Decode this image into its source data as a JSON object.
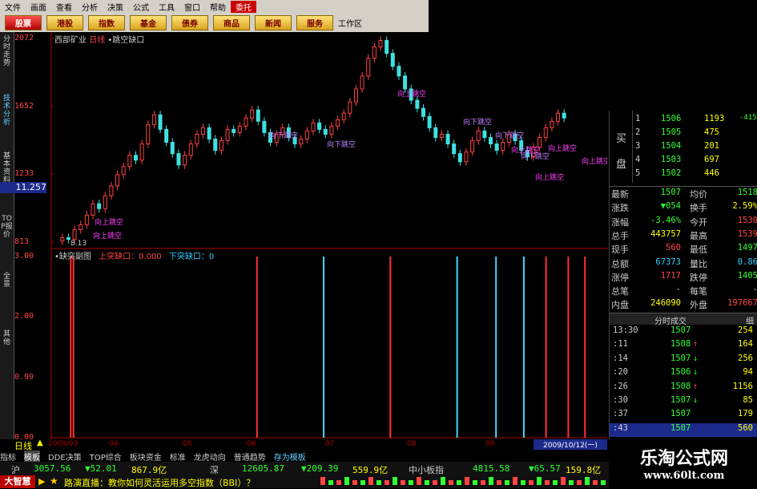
{
  "menu": [
    "文件",
    "画面",
    "查看",
    "分析",
    "决策",
    "公式",
    "工具",
    "窗口",
    "帮助",
    "委托"
  ],
  "buttons": [
    "股票",
    "港股",
    "指数",
    "基金",
    "债券",
    "商品",
    "新闻",
    "服务"
  ],
  "workspace_label": "工作区",
  "left_tabs": [
    "分时走势",
    "技术分析",
    "基本资料",
    "TOP报价",
    "全景",
    "其他"
  ],
  "chart": {
    "title_stock": "西部矿业",
    "title_period": "日线",
    "title_indicator": "•跳空缺口",
    "price_axis": [
      "2072",
      "1652",
      "1233",
      "813"
    ],
    "cursor_value": "11.257",
    "low_mark": "8.13",
    "sub_title": "•缺突副图",
    "sub_up_label": "上突缺口：0.000",
    "sub_down_label": "下突缺口：0",
    "sub_axis": [
      "3.00",
      "2.00",
      "0.99",
      "0.00"
    ],
    "gap_labels": [
      "向上跳空",
      "向上跳空",
      "向下跳空",
      "向下跳空",
      "向上跳空",
      "向下跳空",
      "向下跳空",
      "向上跳空",
      "向下跳空",
      "向上跳空",
      "向上跳空",
      "向上跳空"
    ]
  },
  "chart_data": {
    "type": "candlestick",
    "ylim": [
      8.13,
      20.72
    ],
    "y_ticks": [
      20.72,
      16.52,
      12.33,
      8.13
    ],
    "x_ticks": [
      "2009/03",
      "04",
      "05",
      "06",
      "07",
      "08",
      "09"
    ],
    "closes": [
      8.4,
      8.3,
      8.9,
      9.2,
      9.8,
      10.5,
      10.2,
      11,
      11.6,
      12.3,
      12.8,
      13.5,
      13.2,
      14.2,
      15.4,
      16.0,
      15.1,
      14.3,
      13.6,
      12.9,
      13.5,
      14.2,
      14.8,
      15.2,
      14.5,
      13.8,
      14.4,
      15.1,
      14.9,
      15.3,
      15.8,
      16.3,
      15.6,
      14.9,
      14.3,
      14.8,
      15.2,
      14.6,
      14.2,
      14.5,
      15.0,
      15.5,
      15.1,
      14.8,
      15.3,
      15.7,
      16.1,
      16.8,
      17.6,
      18.4,
      19.5,
      20.2,
      20.6,
      19.8,
      19.0,
      18.4,
      17.6,
      16.9,
      16.4,
      15.9,
      15.2,
      14.6,
      14.8,
      14.2,
      13.6,
      13.1,
      13.7,
      14.4,
      15.0,
      14.6,
      14.2,
      13.8,
      14.3,
      14.8,
      14.4,
      13.8,
      13.4,
      14.0,
      14.6,
      15.2,
      15.6,
      16.1,
      15.8
    ],
    "sub_signal_x": [
      0.035,
      0.04,
      0.37,
      0.49,
      0.61,
      0.73,
      0.8,
      0.85,
      0.89,
      0.93,
      0.96
    ],
    "sub_signal_color": [
      "red",
      "red",
      "red",
      "cyan",
      "red",
      "cyan",
      "cyan",
      "cyan",
      "red",
      "red",
      "red"
    ],
    "sub_signal_value": [
      3,
      3,
      3,
      3,
      3,
      3,
      3,
      3,
      3,
      3,
      3
    ]
  },
  "orderbook": {
    "side_labels": [
      "买",
      "盘"
    ],
    "rows": [
      {
        "n": "1",
        "price": "1506",
        "vol": "1193",
        "chg": "-415"
      },
      {
        "n": "2",
        "price": "1505",
        "vol": "475",
        "chg": ""
      },
      {
        "n": "3",
        "price": "1504",
        "vol": "201",
        "chg": ""
      },
      {
        "n": "4",
        "price": "1503",
        "vol": "697",
        "chg": ""
      },
      {
        "n": "5",
        "price": "1502",
        "vol": "446",
        "chg": ""
      }
    ]
  },
  "quote": [
    {
      "l": "最新",
      "v": "1507",
      "l2": "均价",
      "v2": "1518"
    },
    {
      "l": "涨跌",
      "v": "▼054",
      "l2": "换手",
      "v2": "2.59%"
    },
    {
      "l": "涨幅",
      "v": "-3.46%",
      "l2": "今开",
      "v2": "1530"
    },
    {
      "l": "总手",
      "v": "443757",
      "l2": "最高",
      "v2": "1539"
    },
    {
      "l": "现手",
      "v": "560",
      "l2": "最低",
      "v2": "1497"
    },
    {
      "l": "总额",
      "v": "67373",
      "l2": "量比",
      "v2": "0.86"
    },
    {
      "l": "涨停",
      "v": "1717",
      "l2": "跌停",
      "v2": "1405"
    },
    {
      "l": "总笔",
      "v": "-",
      "l2": "每笔",
      "v2": "-"
    },
    {
      "l": "内盘",
      "v": "246090",
      "l2": "外盘",
      "v2": "197667"
    }
  ],
  "trades_header": "分时成交",
  "trades_tab": "细",
  "trades": [
    {
      "t": "13:30",
      "p": "1507",
      "d": "",
      "v": "254"
    },
    {
      "t": ":11",
      "p": "1508",
      "d": "↑",
      "v": "164"
    },
    {
      "t": ":14",
      "p": "1507",
      "d": "↓",
      "v": "256"
    },
    {
      "t": ":20",
      "p": "1506",
      "d": "↓",
      "v": "94"
    },
    {
      "t": ":26",
      "p": "1508",
      "d": "↑",
      "v": "1156"
    },
    {
      "t": ":30",
      "p": "1507",
      "d": "↓",
      "v": "85"
    },
    {
      "t": ":37",
      "p": "1507",
      "d": "",
      "v": "179"
    },
    {
      "t": ":43",
      "p": "1507",
      "d": "",
      "v": "560"
    }
  ],
  "bottom": {
    "period": "日线",
    "date_axis": [
      "2009/03",
      "04",
      "05",
      "06",
      "07",
      "08",
      "09"
    ],
    "current_date": "2009/10/12(一)",
    "tabs": [
      "指标",
      "模板",
      "DDE决策",
      "TOP综合",
      "板块资金",
      "标准",
      "龙虎动向",
      "普通趋势",
      "存为模板"
    ],
    "index_line": [
      {
        "name": "沪",
        "val": "3057.56",
        "chg": "▼52.01",
        "amt": "867.9亿"
      },
      {
        "name": "深",
        "val": "12605.87",
        "chg": "▼209.39",
        "amt": "559.9亿"
      },
      {
        "name": "中小板指",
        "val": "4815.58",
        "chg": "▼65.57",
        "amt": "159.8亿"
      }
    ],
    "brand": "大智慧",
    "news": "路演直播：教你如何灵活运用多空指数（BBI）？"
  },
  "watermark": {
    "line1": "乐淘公式网",
    "line2": "www.60lt.com"
  }
}
